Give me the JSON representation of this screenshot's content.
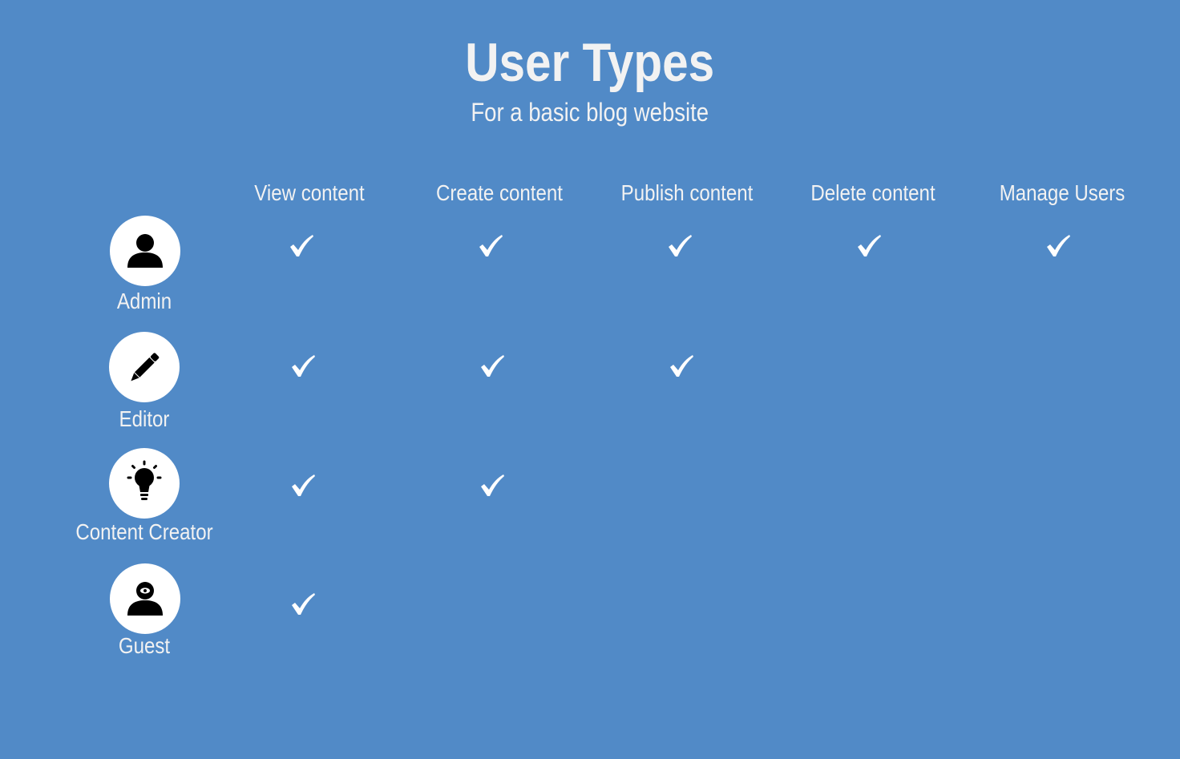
{
  "title": "User Types",
  "subtitle": "For a basic blog website",
  "permissions": [
    "View content",
    "Create content",
    "Publish content",
    "Delete content",
    "Manage Users"
  ],
  "roles": [
    {
      "name": "Admin",
      "icon": "person-icon",
      "grants": [
        true,
        true,
        true,
        true,
        true
      ]
    },
    {
      "name": "Editor",
      "icon": "pencil-icon",
      "grants": [
        true,
        true,
        true,
        false,
        false
      ]
    },
    {
      "name": "Content Creator",
      "icon": "lightbulb-icon",
      "grants": [
        true,
        true,
        false,
        false,
        false
      ]
    },
    {
      "name": "Guest",
      "icon": "person-eye-icon",
      "grants": [
        true,
        false,
        false,
        false,
        false
      ]
    }
  ],
  "colors": {
    "background": "#518ac7",
    "text": "#f2f2f2",
    "icon_circle": "#ffffff",
    "icon_glyph": "#000000",
    "check": "#ffffff"
  }
}
